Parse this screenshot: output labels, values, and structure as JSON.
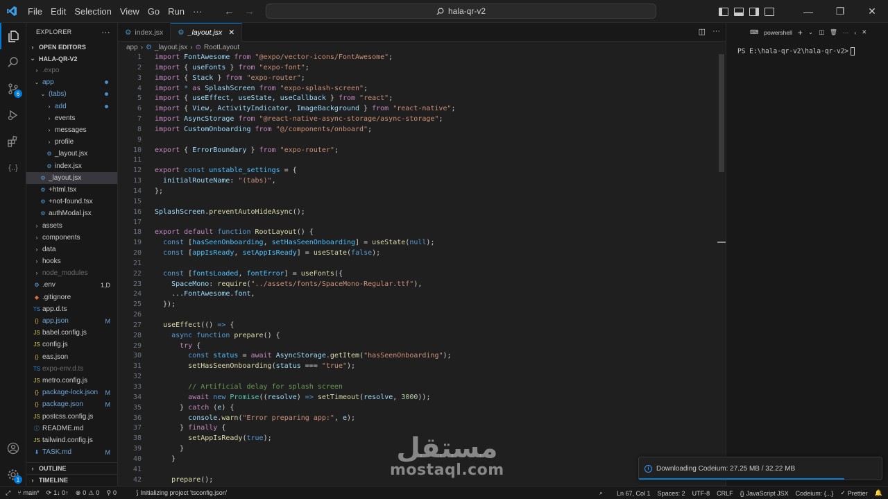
{
  "titlebar": {
    "menu": [
      "File",
      "Edit",
      "Selection",
      "View",
      "Go",
      "Run",
      "···"
    ],
    "search_text": "hala-qr-v2"
  },
  "sidebar": {
    "title": "EXPLORER",
    "open_editors": "OPEN EDITORS",
    "project": "HALA-QR-V2",
    "tree": [
      {
        "label": ".expo",
        "kind": "folder",
        "indent": 1,
        "dim": true
      },
      {
        "label": "app",
        "kind": "folder-open",
        "indent": 1,
        "mod": true,
        "dot": true
      },
      {
        "label": "(tabs)",
        "kind": "folder-open",
        "indent": 2,
        "mod": true,
        "dot": true
      },
      {
        "label": "add",
        "kind": "folder",
        "indent": 3,
        "mod": true,
        "dot": true
      },
      {
        "label": "events",
        "kind": "folder",
        "indent": 3
      },
      {
        "label": "messages",
        "kind": "folder",
        "indent": 3
      },
      {
        "label": "profile",
        "kind": "folder",
        "indent": 3
      },
      {
        "label": "_layout.jsx",
        "kind": "gear",
        "indent": 3
      },
      {
        "label": "index.jsx",
        "kind": "gear",
        "indent": 3
      },
      {
        "label": "_layout.jsx",
        "kind": "gear",
        "indent": 2,
        "selected": true
      },
      {
        "label": "+html.tsx",
        "kind": "gear",
        "indent": 2
      },
      {
        "label": "+not-found.tsx",
        "kind": "gear",
        "indent": 2
      },
      {
        "label": "authModal.jsx",
        "kind": "gear",
        "indent": 2
      },
      {
        "label": "assets",
        "kind": "folder",
        "indent": 1
      },
      {
        "label": "components",
        "kind": "folder",
        "indent": 1
      },
      {
        "label": "data",
        "kind": "folder",
        "indent": 1
      },
      {
        "label": "hooks",
        "kind": "folder",
        "indent": 1
      },
      {
        "label": "node_modules",
        "kind": "folder",
        "indent": 1,
        "dim": true
      },
      {
        "label": ".env",
        "kind": "gear",
        "indent": 1,
        "status": "1,D"
      },
      {
        "label": ".gitignore",
        "kind": "git",
        "indent": 1
      },
      {
        "label": "app.d.ts",
        "kind": "ts",
        "indent": 1
      },
      {
        "label": "app.json",
        "kind": "json",
        "indent": 1,
        "mod": true,
        "status": "M"
      },
      {
        "label": "babel.config.js",
        "kind": "js",
        "indent": 1
      },
      {
        "label": "config.js",
        "kind": "js",
        "indent": 1
      },
      {
        "label": "eas.json",
        "kind": "json",
        "indent": 1
      },
      {
        "label": "expo-env.d.ts",
        "kind": "ts",
        "indent": 1,
        "dim": true
      },
      {
        "label": "metro.config.js",
        "kind": "js",
        "indent": 1
      },
      {
        "label": "package-lock.json",
        "kind": "json",
        "indent": 1,
        "mod": true,
        "status": "M"
      },
      {
        "label": "package.json",
        "kind": "json",
        "indent": 1,
        "mod": true,
        "status": "M"
      },
      {
        "label": "postcss.config.js",
        "kind": "js",
        "indent": 1
      },
      {
        "label": "README.md",
        "kind": "info",
        "indent": 1
      },
      {
        "label": "tailwind.config.js",
        "kind": "js",
        "indent": 1
      },
      {
        "label": "TASK.md",
        "kind": "md",
        "indent": 1,
        "mod": true,
        "status": "M"
      }
    ],
    "outline": "OUTLINE",
    "timeline": "TIMELINE"
  },
  "tabs": [
    {
      "label": "index.jsx",
      "active": false
    },
    {
      "label": "_layout.jsx",
      "active": true
    }
  ],
  "breadcrumb": [
    "app",
    "_layout.jsx",
    "RootLayout"
  ],
  "editor": {
    "lines": [
      [
        [
          "kw",
          "import "
        ],
        [
          "vr",
          "FontAwesome "
        ],
        [
          "kw",
          "from "
        ],
        [
          "st2",
          "\"@expo/vector-icons/FontAwesome\""
        ],
        [
          "pn",
          ";"
        ]
      ],
      [
        [
          "kw",
          "import "
        ],
        [
          "pn",
          "{ "
        ],
        [
          "vr",
          "useFonts "
        ],
        [
          "pn",
          "} "
        ],
        [
          "kw",
          "from "
        ],
        [
          "st2",
          "\"expo-font\""
        ],
        [
          "pn",
          ";"
        ]
      ],
      [
        [
          "kw",
          "import "
        ],
        [
          "pn",
          "{ "
        ],
        [
          "vr",
          "Stack "
        ],
        [
          "pn",
          "} "
        ],
        [
          "kw",
          "from "
        ],
        [
          "st2",
          "\"expo-router\""
        ],
        [
          "pn",
          ";"
        ]
      ],
      [
        [
          "kw",
          "import "
        ],
        [
          "bl",
          "* "
        ],
        [
          "kw",
          "as "
        ],
        [
          "vr",
          "SplashScreen "
        ],
        [
          "kw",
          "from "
        ],
        [
          "st2",
          "\"expo-splash-screen\""
        ],
        [
          "pn",
          ";"
        ]
      ],
      [
        [
          "kw",
          "import "
        ],
        [
          "pn",
          "{ "
        ],
        [
          "vr",
          "useEffect, useState, useCallback "
        ],
        [
          "pn",
          "} "
        ],
        [
          "kw",
          "from "
        ],
        [
          "st2",
          "\"react\""
        ],
        [
          "pn",
          ";"
        ]
      ],
      [
        [
          "kw",
          "import "
        ],
        [
          "pn",
          "{ "
        ],
        [
          "vr",
          "View, ActivityIndicator, ImageBackground "
        ],
        [
          "pn",
          "} "
        ],
        [
          "kw",
          "from "
        ],
        [
          "st2",
          "\"react-native\""
        ],
        [
          "pn",
          ";"
        ]
      ],
      [
        [
          "kw",
          "import "
        ],
        [
          "vr",
          "AsyncStorage "
        ],
        [
          "kw",
          "from "
        ],
        [
          "st2",
          "\"@react-native-async-storage/async-storage\""
        ],
        [
          "pn",
          ";"
        ]
      ],
      [
        [
          "kw",
          "import "
        ],
        [
          "vr",
          "CustomOnboarding "
        ],
        [
          "kw",
          "from "
        ],
        [
          "st2",
          "\"@/components/onboard\""
        ],
        [
          "pn",
          ";"
        ]
      ],
      [],
      [
        [
          "kw",
          "export "
        ],
        [
          "pn",
          "{ "
        ],
        [
          "vr",
          "ErrorBoundary "
        ],
        [
          "pn",
          "} "
        ],
        [
          "kw",
          "from "
        ],
        [
          "st2",
          "\"expo-router\""
        ],
        [
          "pn",
          ";"
        ]
      ],
      [],
      [
        [
          "kw",
          "export "
        ],
        [
          "bl",
          "const "
        ],
        [
          "cn",
          "unstable_settings "
        ],
        [
          "pn",
          "= {"
        ]
      ],
      [
        [
          "pn",
          "  "
        ],
        [
          "vr",
          "initialRouteName"
        ],
        [
          "pn",
          ": "
        ],
        [
          "st2",
          "\"(tabs)\""
        ],
        [
          "pn",
          ","
        ]
      ],
      [
        [
          "pn",
          "};"
        ]
      ],
      [],
      [
        [
          "vr",
          "SplashScreen"
        ],
        [
          "pn",
          "."
        ],
        [
          "fn",
          "preventAutoHideAsync"
        ],
        [
          "pn",
          "();"
        ]
      ],
      [],
      [
        [
          "kw",
          "export default "
        ],
        [
          "bl",
          "function "
        ],
        [
          "fn",
          "RootLayout"
        ],
        [
          "pn",
          "() {"
        ]
      ],
      [
        [
          "pn",
          "  "
        ],
        [
          "bl",
          "const "
        ],
        [
          "pn",
          "["
        ],
        [
          "cn",
          "hasSeenOnboarding"
        ],
        [
          "pn",
          ", "
        ],
        [
          "cn",
          "setHasSeenOnboarding"
        ],
        [
          "pn",
          "] = "
        ],
        [
          "fn",
          "useState"
        ],
        [
          "pn",
          "("
        ],
        [
          "bl",
          "null"
        ],
        [
          "pn",
          ");"
        ]
      ],
      [
        [
          "pn",
          "  "
        ],
        [
          "bl",
          "const "
        ],
        [
          "pn",
          "["
        ],
        [
          "cn",
          "appIsReady"
        ],
        [
          "pn",
          ", "
        ],
        [
          "cn",
          "setAppIsReady"
        ],
        [
          "pn",
          "] = "
        ],
        [
          "fn",
          "useState"
        ],
        [
          "pn",
          "("
        ],
        [
          "bl",
          "false"
        ],
        [
          "pn",
          ");"
        ]
      ],
      [],
      [
        [
          "pn",
          "  "
        ],
        [
          "bl",
          "const "
        ],
        [
          "pn",
          "["
        ],
        [
          "cn",
          "fontsLoaded"
        ],
        [
          "pn",
          ", "
        ],
        [
          "cn",
          "fontError"
        ],
        [
          "pn",
          "] = "
        ],
        [
          "fn",
          "useFonts"
        ],
        [
          "pn",
          "({"
        ]
      ],
      [
        [
          "pn",
          "    "
        ],
        [
          "vr",
          "SpaceMono"
        ],
        [
          "pn",
          ": "
        ],
        [
          "fn",
          "require"
        ],
        [
          "pn",
          "("
        ],
        [
          "st2",
          "\"../assets/fonts/SpaceMono-Regular.ttf\""
        ],
        [
          "pn",
          "),"
        ]
      ],
      [
        [
          "pn",
          "    ..."
        ],
        [
          "vr",
          "FontAwesome"
        ],
        [
          "pn",
          "."
        ],
        [
          "vr",
          "font"
        ],
        [
          "pn",
          ","
        ]
      ],
      [
        [
          "pn",
          "  });"
        ]
      ],
      [],
      [
        [
          "pn",
          "  "
        ],
        [
          "fn",
          "useEffect"
        ],
        [
          "pn",
          "(() "
        ],
        [
          "bl",
          "=> "
        ],
        [
          "pn",
          "{"
        ]
      ],
      [
        [
          "pn",
          "    "
        ],
        [
          "bl",
          "async function "
        ],
        [
          "fn",
          "prepare"
        ],
        [
          "pn",
          "() {"
        ]
      ],
      [
        [
          "pn",
          "      "
        ],
        [
          "kw",
          "try "
        ],
        [
          "pn",
          "{"
        ]
      ],
      [
        [
          "pn",
          "        "
        ],
        [
          "bl",
          "const "
        ],
        [
          "cn",
          "status "
        ],
        [
          "pn",
          "= "
        ],
        [
          "kw",
          "await "
        ],
        [
          "vr",
          "AsyncStorage"
        ],
        [
          "pn",
          "."
        ],
        [
          "fn",
          "getItem"
        ],
        [
          "pn",
          "("
        ],
        [
          "st2",
          "\"hasSeenOnboarding\""
        ],
        [
          "pn",
          ");"
        ]
      ],
      [
        [
          "pn",
          "        "
        ],
        [
          "fn",
          "setHasSeenOnboarding"
        ],
        [
          "pn",
          "("
        ],
        [
          "vr",
          "status "
        ],
        [
          "pn",
          "=== "
        ],
        [
          "st2",
          "\"true\""
        ],
        [
          "pn",
          ");"
        ]
      ],
      [],
      [
        [
          "pn",
          "        "
        ],
        [
          "cm",
          "// Artificial delay for splash screen"
        ]
      ],
      [
        [
          "pn",
          "        "
        ],
        [
          "kw",
          "await "
        ],
        [
          "bl",
          "new "
        ],
        [
          "ty",
          "Promise"
        ],
        [
          "pn",
          "(("
        ],
        [
          "vr",
          "resolve"
        ],
        [
          "pn",
          ") "
        ],
        [
          "bl",
          "=> "
        ],
        [
          "fn",
          "setTimeout"
        ],
        [
          "pn",
          "("
        ],
        [
          "vr",
          "resolve"
        ],
        [
          "pn",
          ", "
        ],
        [
          "nm",
          "3000"
        ],
        [
          "pn",
          "));"
        ]
      ],
      [
        [
          "pn",
          "      } "
        ],
        [
          "kw",
          "catch "
        ],
        [
          "pn",
          "("
        ],
        [
          "vr",
          "e"
        ],
        [
          "pn",
          ") {"
        ]
      ],
      [
        [
          "pn",
          "        "
        ],
        [
          "vr",
          "console"
        ],
        [
          "pn",
          "."
        ],
        [
          "fn",
          "warn"
        ],
        [
          "pn",
          "("
        ],
        [
          "st2",
          "\"Error preparing app:\""
        ],
        [
          "pn",
          ", "
        ],
        [
          "vr",
          "e"
        ],
        [
          "pn",
          ");"
        ]
      ],
      [
        [
          "pn",
          "      } "
        ],
        [
          "kw",
          "finally "
        ],
        [
          "pn",
          "{"
        ]
      ],
      [
        [
          "pn",
          "        "
        ],
        [
          "fn",
          "setAppIsReady"
        ],
        [
          "pn",
          "("
        ],
        [
          "bl",
          "true"
        ],
        [
          "pn",
          ");"
        ]
      ],
      [
        [
          "pn",
          "      }"
        ]
      ],
      [
        [
          "pn",
          "    }"
        ]
      ],
      [],
      [
        [
          "pn",
          "    "
        ],
        [
          "fn",
          "prepare"
        ],
        [
          "pn",
          "();"
        ]
      ]
    ]
  },
  "terminal": {
    "shell": "powershell",
    "prompt": "PS E:\\hala-qr-v2\\hala-qr-v2>"
  },
  "notification": {
    "text": "Downloading Codeium: 27.25 MB / 32.22 MB",
    "progress": 0.846
  },
  "watermark": {
    "arabic": "مستقل",
    "latin": "mostaql.com"
  },
  "statusbar": {
    "branch": "main*",
    "sync": "1↓ 0↑",
    "errors": "0",
    "warnings": "0",
    "ports": "0",
    "task": "Initializing project 'tsconfig.json'",
    "position": "Ln 67, Col 1",
    "spaces": "Spaces: 2",
    "encoding": "UTF-8",
    "eol": "CRLF",
    "language": "JavaScript JSX",
    "codeium": "Codeium: {...}",
    "prettier": "Prettier"
  },
  "colors": {
    "accent": "#0078d4",
    "modified": "#6fa6d8"
  }
}
